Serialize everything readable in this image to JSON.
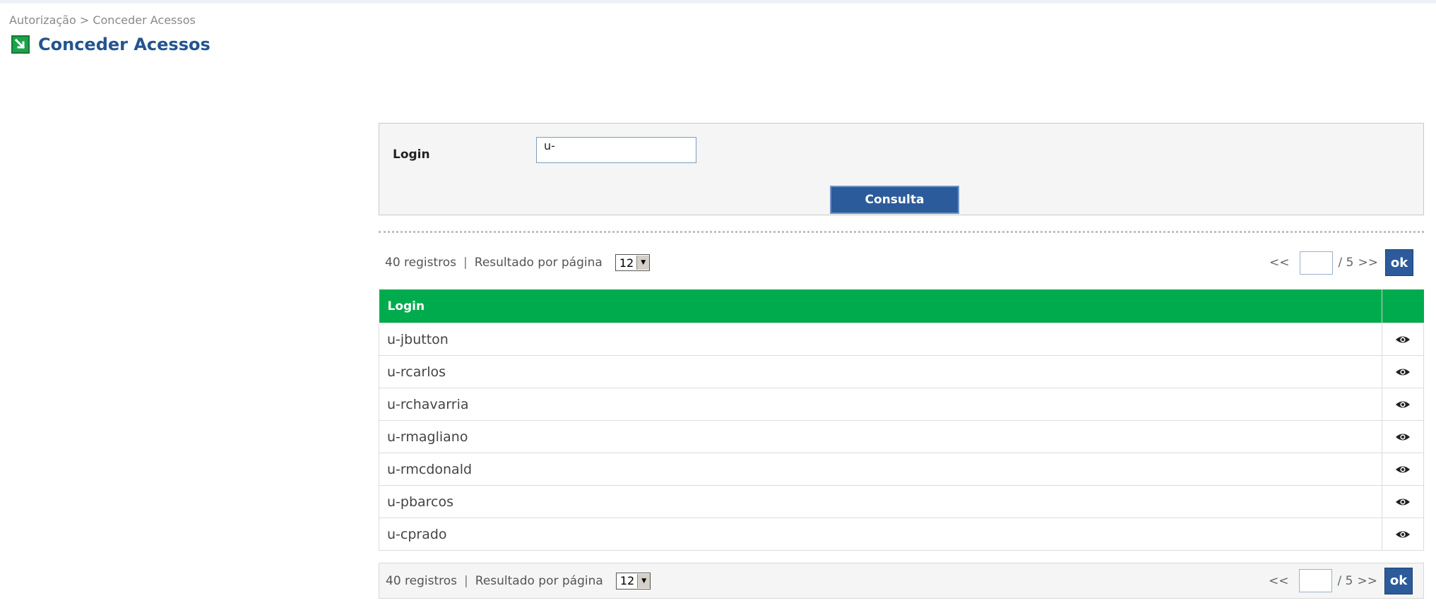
{
  "breadcrumb": "Autorização > Conceder Acessos",
  "page_title": "Conceder Acessos",
  "colors": {
    "title": "#23558f",
    "header_green": "#00ab4e",
    "button_blue": "#2c5b9b"
  },
  "search": {
    "label": "Login",
    "value": "u-",
    "button": "Consulta"
  },
  "pager": {
    "count_text": "40 registros",
    "separator": "|",
    "per_page_label": "Resultado por página",
    "per_page_value": "12",
    "prev": "<<",
    "page_total": "/ 5",
    "next": ">>",
    "ok": "ok"
  },
  "table": {
    "header_login": "Login",
    "rows": [
      {
        "login": "u-jbutton",
        "action_icon": "view-icon"
      },
      {
        "login": "u-rcarlos",
        "action_icon": "view-icon"
      },
      {
        "login": "u-rchavarria",
        "action_icon": "view-icon"
      },
      {
        "login": "u-rmagliano",
        "action_icon": "view-icon"
      },
      {
        "login": "u-rmcdonald",
        "action_icon": "view-icon"
      },
      {
        "login": "u-pbarcos",
        "action_icon": "view-icon"
      },
      {
        "login": "u-cprado",
        "action_icon": "view-icon"
      }
    ]
  }
}
